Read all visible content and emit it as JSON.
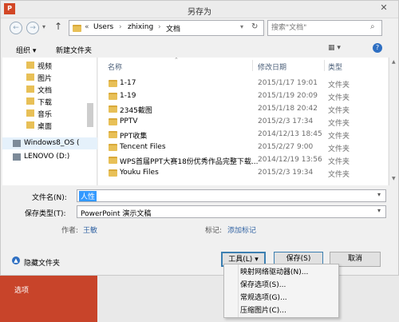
{
  "window": {
    "title": "另存为",
    "app_icon": "P"
  },
  "nav": {
    "back_icon": "back-arrow",
    "forward_icon": "forward-arrow",
    "up_icon": "up-arrow"
  },
  "address": {
    "prefix": "«",
    "crumbs": [
      "Users",
      "zhixing",
      "文档"
    ]
  },
  "search": {
    "placeholder": "搜索\"文档\""
  },
  "toolbar": {
    "organize": "组织 ▾",
    "new_folder": "新建文件夹"
  },
  "sidebar": {
    "items": [
      {
        "label": "视频",
        "icon": "video-icon"
      },
      {
        "label": "图片",
        "icon": "picture-icon"
      },
      {
        "label": "文档",
        "icon": "document-icon"
      },
      {
        "label": "下载",
        "icon": "download-icon"
      },
      {
        "label": "音乐",
        "icon": "music-icon"
      },
      {
        "label": "桌面",
        "icon": "desktop-icon"
      },
      {
        "label": "Windows8_OS (",
        "icon": "drive-icon"
      },
      {
        "label": "LENOVO (D:)",
        "icon": "drive-icon"
      }
    ]
  },
  "filelist": {
    "columns": {
      "name": "名称",
      "date": "修改日期",
      "type": "类型"
    },
    "rows": [
      {
        "name": "1-17",
        "date": "2015/1/17 19:01",
        "type": "文件夹"
      },
      {
        "name": "1-19",
        "date": "2015/1/19 20:09",
        "type": "文件夹"
      },
      {
        "name": "2345截图",
        "date": "2015/1/18 20:42",
        "type": "文件夹"
      },
      {
        "name": "PPTV",
        "date": "2015/2/3 17:34",
        "type": "文件夹"
      },
      {
        "name": "PPT收集",
        "date": "2014/12/13 18:45",
        "type": "文件夹"
      },
      {
        "name": "Tencent Files",
        "date": "2015/2/27 9:00",
        "type": "文件夹"
      },
      {
        "name": "WPS首届PPT大赛18份优秀作品完整下载...",
        "date": "2014/12/19 13:56",
        "type": "文件夹"
      },
      {
        "name": "Youku Files",
        "date": "2015/2/3 19:34",
        "type": "文件夹"
      }
    ]
  },
  "form": {
    "filename_label": "文件名(N):",
    "filename_value": "人性",
    "savetype_label": "保存类型(T):",
    "savetype_value": "PowerPoint 演示文稿",
    "author_label": "作者:",
    "author_value": "王敏",
    "tags_label": "标记:",
    "tags_value": "添加标记"
  },
  "footer": {
    "hide_folders": "隐藏文件夹",
    "tools": "工具(L)",
    "save": "保存(S)",
    "cancel": "取消"
  },
  "tools_menu": {
    "items": [
      "映射网络驱动器(N)...",
      "保存选项(S)...",
      "常规选项(G)...",
      "压缩图片(C)..."
    ]
  },
  "background": {
    "label": "选项"
  },
  "colors": {
    "accent": "#3399ff",
    "app_red": "#d24726",
    "folder": "#e8c057",
    "link": "#3465a4"
  }
}
